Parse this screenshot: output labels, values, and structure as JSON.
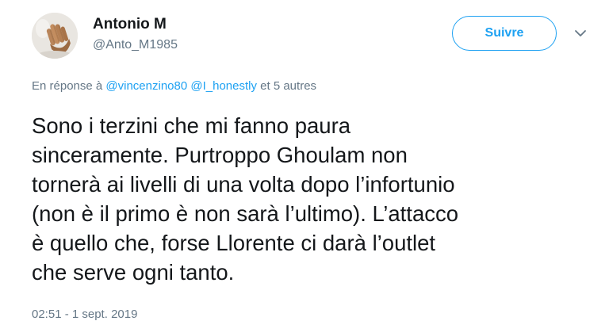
{
  "author": {
    "name": "Antonio M",
    "handle": "@Anto_M1985",
    "avatar_icon": "hand-avatar"
  },
  "follow_button": {
    "label": "Suivre",
    "color": "#1da1f2"
  },
  "menu_icon": "chevron-down-icon",
  "reply": {
    "prefix": "En réponse à",
    "mentions": [
      "@vincenzino80",
      "@I_honestly"
    ],
    "suffix": "et 5 autres"
  },
  "tweet": {
    "lines": [
      "Sono i terzini che mi fanno paura",
      "sinceramente. Purtroppo Ghoulam non",
      "tornerà ai livelli di una volta dopo l’infortunio",
      "(non è il primo è non sarà l’ultimo). L’attacco",
      "è quello che, forse Llorente ci darà l’outlet",
      "che serve ogni tanto."
    ]
  },
  "timestamp": "02:51 - 1 sept. 2019",
  "colors": {
    "text": "#14171a",
    "secondary": "#657786",
    "accent": "#1da1f2"
  }
}
